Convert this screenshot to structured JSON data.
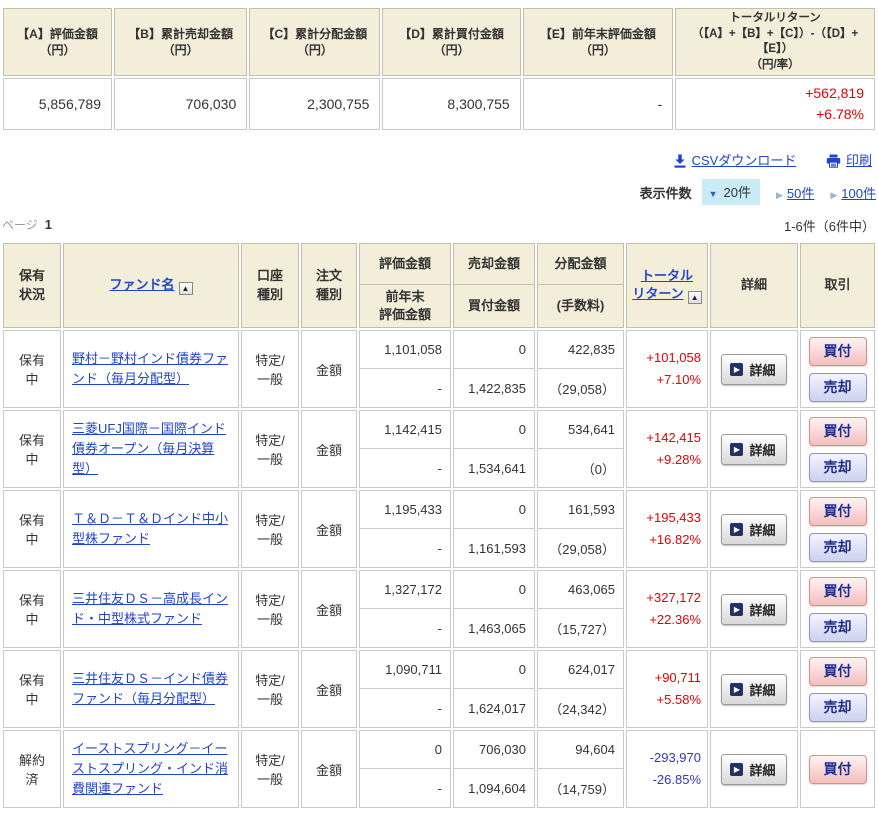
{
  "colors": {
    "positive_return": "#e60000",
    "negative_return": "#3333cc",
    "link": "#2244cc",
    "header_bg": "#f3eed9",
    "selected_count_bg": "#c9ebf5"
  },
  "icons": {
    "sort_asc": "▲",
    "selected_arrow": "▼",
    "option_arrow": "▶",
    "detail_arrow": "▶"
  },
  "summary": {
    "columns": [
      {
        "label": "【A】評価金額\n（円）",
        "value": "5,856,789"
      },
      {
        "label": "【B】累計売却金額\n（円）",
        "value": "706,030"
      },
      {
        "label": "【C】累計分配金額\n（円）",
        "value": "2,300,755"
      },
      {
        "label": "【D】累計買付金額\n（円）",
        "value": "8,300,755"
      },
      {
        "label": "【E】前年末評価金額\n（円）",
        "value": "-"
      },
      {
        "label": "トータルリターン\n（【A】+【B】+【C】）-（【D】+【E】）\n（円/率）",
        "value": "+562,819\n+6.78%",
        "wide": true,
        "return_cell": true
      }
    ]
  },
  "toolbar": {
    "csv_label": "CSVダウンロード",
    "print_label": "印刷"
  },
  "display_count": {
    "label": "表示件数",
    "selected": "20件",
    "options": [
      "50件",
      "100件"
    ]
  },
  "pagination": {
    "page_label": "ページ",
    "current_page": "1",
    "result_range": "1-6件（6件中）"
  },
  "fund_table": {
    "headers": {
      "status": "保有\n状況",
      "fund_name": "ファンド名",
      "account_type": "口座\n種別",
      "order_type": "注文\n種別",
      "eval_top": "評価金額",
      "eval_bottom": "前年末\n評価金額",
      "sell_top": "売却金額",
      "sell_bottom": "買付金額",
      "dist_top": "分配金額",
      "dist_bottom": "(手数料)",
      "total_return": "トータル\nリターン",
      "detail": "詳細",
      "trade": "取引"
    },
    "detail_button_label": "詳細",
    "action_labels": {
      "buy": "買付",
      "sell": "売却"
    },
    "rows": [
      {
        "status": "保有\n中",
        "fund_name": "野村－野村インド債券ファンド（毎月分配型）",
        "account_type": "特定/\n一般",
        "order_type": "金額",
        "eval_amount": "1,101,058",
        "prev_year_eval": "-",
        "sell_amount": "0",
        "buy_amount": "1,422,835",
        "dist_amount": "422,835",
        "fee": "（29,058）",
        "return_amount": "+101,058",
        "return_rate": "+7.10%",
        "negative": false,
        "actions": [
          "buy",
          "sell"
        ]
      },
      {
        "status": "保有\n中",
        "fund_name": "三菱UFJ国際－国際インド債券オープン（毎月決算型）",
        "account_type": "特定/\n一般",
        "order_type": "金額",
        "eval_amount": "1,142,415",
        "prev_year_eval": "-",
        "sell_amount": "0",
        "buy_amount": "1,534,641",
        "dist_amount": "534,641",
        "fee": "（0）",
        "return_amount": "+142,415",
        "return_rate": "+9.28%",
        "negative": false,
        "actions": [
          "buy",
          "sell"
        ]
      },
      {
        "status": "保有\n中",
        "fund_name": "Ｔ＆Ｄ－Ｔ＆Ｄインド中小型株ファンド",
        "account_type": "特定/\n一般",
        "order_type": "金額",
        "eval_amount": "1,195,433",
        "prev_year_eval": "-",
        "sell_amount": "0",
        "buy_amount": "1,161,593",
        "dist_amount": "161,593",
        "fee": "（29,058）",
        "return_amount": "+195,433",
        "return_rate": "+16.82%",
        "negative": false,
        "actions": [
          "buy",
          "sell"
        ]
      },
      {
        "status": "保有\n中",
        "fund_name": "三井住友ＤＳ－高成長インド・中型株式ファンド",
        "account_type": "特定/\n一般",
        "order_type": "金額",
        "eval_amount": "1,327,172",
        "prev_year_eval": "-",
        "sell_amount": "0",
        "buy_amount": "1,463,065",
        "dist_amount": "463,065",
        "fee": "（15,727）",
        "return_amount": "+327,172",
        "return_rate": "+22.36%",
        "negative": false,
        "actions": [
          "buy",
          "sell"
        ]
      },
      {
        "status": "保有\n中",
        "fund_name": "三井住友ＤＳ－インド債券ファンド（毎月分配型）",
        "account_type": "特定/\n一般",
        "order_type": "金額",
        "eval_amount": "1,090,711",
        "prev_year_eval": "-",
        "sell_amount": "0",
        "buy_amount": "1,624,017",
        "dist_amount": "624,017",
        "fee": "（24,342）",
        "return_amount": "+90,711",
        "return_rate": "+5.58%",
        "negative": false,
        "actions": [
          "buy",
          "sell"
        ]
      },
      {
        "status": "解約\n済",
        "fund_name": "イーストスプリング－イーストスプリング・インド消費関連ファンド",
        "account_type": "特定/\n一般",
        "order_type": "金額",
        "eval_amount": "0",
        "prev_year_eval": "-",
        "sell_amount": "706,030",
        "buy_amount": "1,094,604",
        "dist_amount": "94,604",
        "fee": "（14,759）",
        "return_amount": "-293,970",
        "return_rate": "-26.85%",
        "negative": true,
        "actions": [
          "buy"
        ]
      }
    ]
  }
}
